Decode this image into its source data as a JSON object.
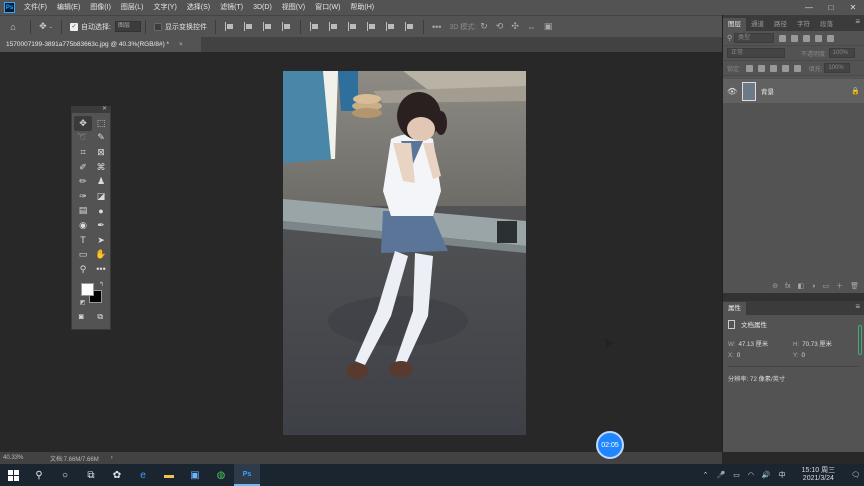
{
  "menubar": {
    "items": [
      "文件(F)",
      "编辑(E)",
      "图像(I)",
      "图层(L)",
      "文字(Y)",
      "选择(S)",
      "滤镜(T)",
      "3D(D)",
      "视图(V)",
      "窗口(W)",
      "帮助(H)"
    ],
    "window_controls": [
      "—",
      "□",
      "✕"
    ]
  },
  "options": {
    "auto_select_label": "自动选择:",
    "auto_select_value": "图层",
    "show_transform_label": "显示变换控件",
    "mode3d_label": "3D 模式:",
    "more": "•••"
  },
  "document": {
    "tab_title": "1570007199-3891a775b83663c.jpg @ 40.3%(RGB/8#) *",
    "tab_close": "×"
  },
  "layers_panel": {
    "tabs": [
      "图层",
      "通道",
      "路径",
      "字符",
      "段落"
    ],
    "kind_placeholder": "类型",
    "blend_mode": "正常",
    "opacity_label": "不透明度:",
    "opacity_value": "100%",
    "lock_label": "锁定:",
    "fill_label": "填充:",
    "fill_value": "100%",
    "layer_name": "背景",
    "footer_icons": [
      "⊝",
      "fx",
      "◧",
      "◑",
      "▭",
      "＋",
      "🗑"
    ]
  },
  "properties_panel": {
    "tab": "属性",
    "title": "文档属性",
    "w_label": "W:",
    "w_value": "47.13 厘米",
    "h_label": "H:",
    "h_value": "70.73 厘米",
    "x_label": "X:",
    "x_value": "0",
    "y_label": "Y:",
    "y_value": "0",
    "resolution": "分辨率: 72 像素/英寸"
  },
  "status": {
    "zoom": "40.33%",
    "doc_size": "文档:7.66M/7.66M",
    "arrow": "›"
  },
  "timer": "02:05",
  "taskbar": {
    "time": "15:10 周三",
    "date": "2021/3/24",
    "lang": "中"
  }
}
